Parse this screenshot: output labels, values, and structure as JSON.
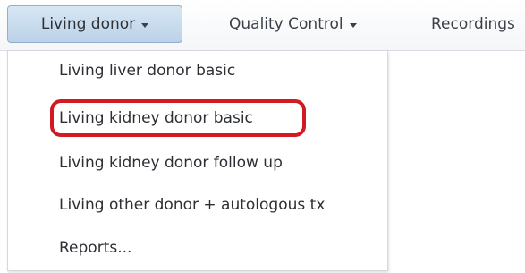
{
  "navbar": {
    "items": [
      {
        "label": "Living donor",
        "active": true,
        "has_caret": true
      },
      {
        "label": "Quality Control",
        "active": false,
        "has_caret": true
      },
      {
        "label": "Recordings",
        "active": false,
        "has_caret": false
      }
    ]
  },
  "dropdown": {
    "items": [
      {
        "label": "Living liver donor basic"
      },
      {
        "label": "Living kidney donor basic",
        "highlighted": true
      },
      {
        "label": "Living kidney donor follow up"
      },
      {
        "label": "Living other donor + autologous tx"
      },
      {
        "label": "Reports..."
      }
    ]
  },
  "annotation": {
    "highlight_color": "#d11a22"
  },
  "icons": {
    "caret": "chevron-down-icon"
  }
}
